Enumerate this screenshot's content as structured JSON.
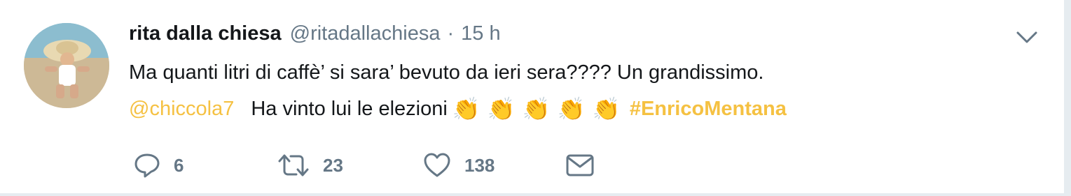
{
  "tweet": {
    "author_name": "rita dalla chiesa",
    "author_handle": "@ritadallachiesa",
    "separator": "·",
    "time": "15 h",
    "line1": "Ma quanti litri di caffè’ si sara’ bevuto da ieri sera???? Un grandissimo.",
    "mention": "@chiccola7",
    "line2_text": "Ha vinto lui le elezioni",
    "clap_emoji": [
      "👏",
      "👏",
      "👏",
      "👏",
      "👏"
    ],
    "hashtag": "#EnricoMentana"
  },
  "actions": {
    "reply_count": "6",
    "retweet_count": "23",
    "like_count": "138"
  },
  "icons": {
    "reply": "reply-icon",
    "retweet": "retweet-icon",
    "like": "heart-icon",
    "message": "envelope-icon",
    "menu": "chevron-down-icon"
  },
  "colors": {
    "link_accent": "#f5c142",
    "secondary_text": "#657786",
    "primary_text": "#14171a"
  }
}
